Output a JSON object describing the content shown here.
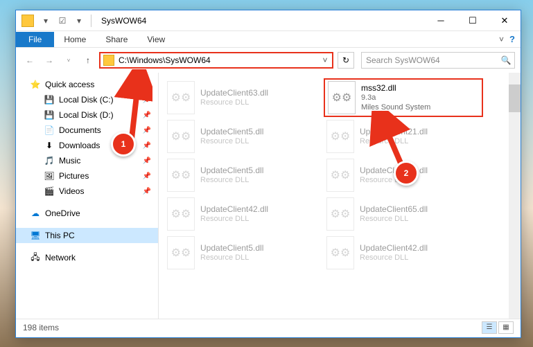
{
  "titlebar": {
    "title": "SysWOW64"
  },
  "ribbon": {
    "file": "File",
    "home": "Home",
    "share": "Share",
    "view": "View"
  },
  "nav": {
    "path": "C:\\Windows\\SysWOW64",
    "searchPlaceholder": "Search SysWOW64"
  },
  "sidebar": {
    "quick": "Quick access",
    "items": [
      {
        "label": "Local Disk (C:)",
        "ico": "💾"
      },
      {
        "label": "Local Disk (D:)",
        "ico": "💾"
      },
      {
        "label": "Documents",
        "ico": "📄"
      },
      {
        "label": "Downloads",
        "ico": "⬇"
      },
      {
        "label": "Music",
        "ico": "🎵"
      },
      {
        "label": "Pictures",
        "ico": "🖼"
      },
      {
        "label": "Videos",
        "ico": "🎬"
      }
    ],
    "onedrive": "OneDrive",
    "thispc": "This PC",
    "network": "Network"
  },
  "files": [
    {
      "name": "UpdateClient63.dll",
      "sub1": "Resource DLL",
      "sub2": "",
      "faded": true,
      "hl": false
    },
    {
      "name": "mss32.dll",
      "sub1": "9.3a",
      "sub2": "Miles Sound System",
      "faded": false,
      "hl": true
    },
    {
      "name": "UpdateClient5.dll",
      "sub1": "Resource DLL",
      "sub2": "",
      "faded": true,
      "hl": false
    },
    {
      "name": "UpdateClient21.dll",
      "sub1": "Resource DLL",
      "sub2": "",
      "faded": true,
      "hl": false
    },
    {
      "name": "UpdateClient5.dll",
      "sub1": "Resource DLL",
      "sub2": "",
      "faded": true,
      "hl": false
    },
    {
      "name": "UpdateClient19.dll",
      "sub1": "Resource DLL",
      "sub2": "",
      "faded": true,
      "hl": false
    },
    {
      "name": "UpdateClient42.dll",
      "sub1": "Resource DLL",
      "sub2": "",
      "faded": true,
      "hl": false
    },
    {
      "name": "UpdateClient65.dll",
      "sub1": "Resource DLL",
      "sub2": "",
      "faded": true,
      "hl": false
    },
    {
      "name": "UpdateClient5.dll",
      "sub1": "Resource DLL",
      "sub2": "",
      "faded": true,
      "hl": false
    },
    {
      "name": "UpdateClient42.dll",
      "sub1": "Resource DLL",
      "sub2": "",
      "faded": true,
      "hl": false
    }
  ],
  "status": {
    "count": "198 items"
  },
  "annot": {
    "b1": "1",
    "b2": "2"
  }
}
